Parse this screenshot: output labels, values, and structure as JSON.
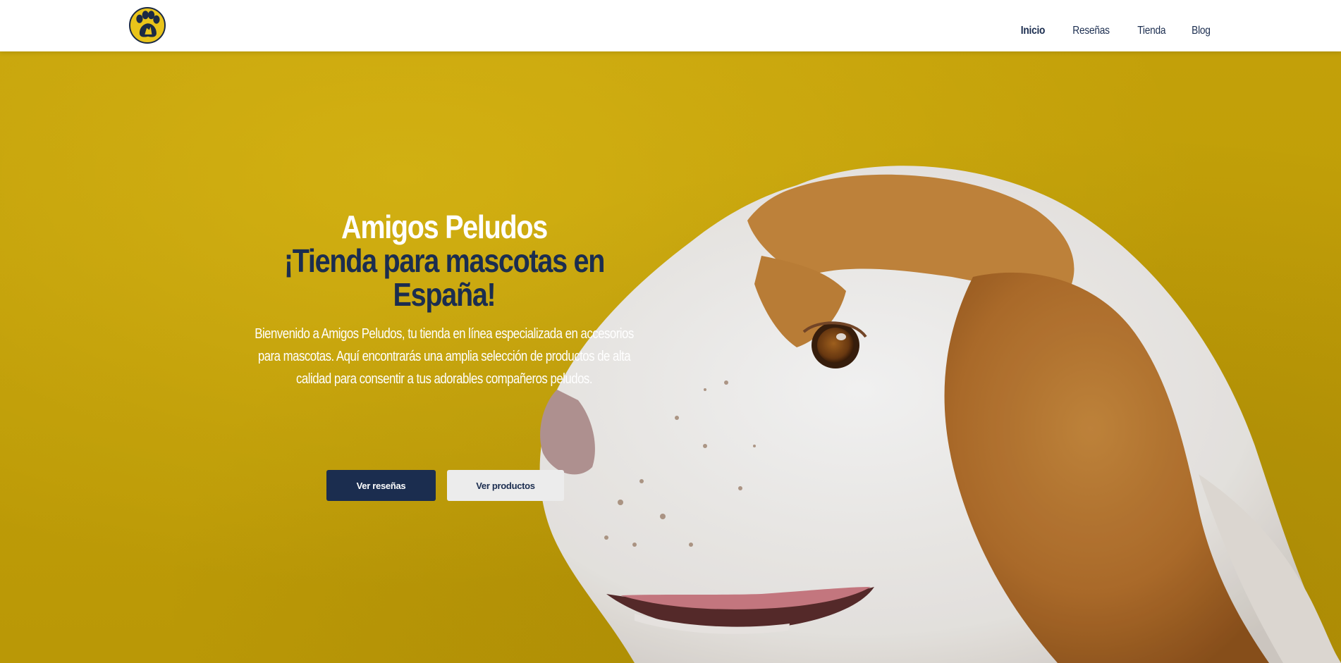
{
  "brand": {
    "logo_icon": "paw-dog-logo-icon",
    "colors": {
      "navy": "#1b2d4f",
      "yellow": "#c9a507",
      "logo_yellow": "#e9c41a"
    }
  },
  "nav": {
    "items": [
      {
        "label": "Inicio",
        "active": true
      },
      {
        "label": "Reseñas",
        "active": false
      },
      {
        "label": "Tienda",
        "active": false
      },
      {
        "label": "Blog",
        "active": false
      }
    ]
  },
  "hero": {
    "title": "Amigos Peludos",
    "subtitle": "¡Tienda para mascotas en España!",
    "description": "Bienvenido a Amigos Peludos, tu tienda en línea especializada en accesorios para mascotas. Aquí encontrarás una amplia selección de productos de alta calidad para consentir a tus adorables compañeros peludos.",
    "primary_button": "Ver reseñas",
    "secondary_button": "Ver productos",
    "image": "beagle-profile-image"
  }
}
